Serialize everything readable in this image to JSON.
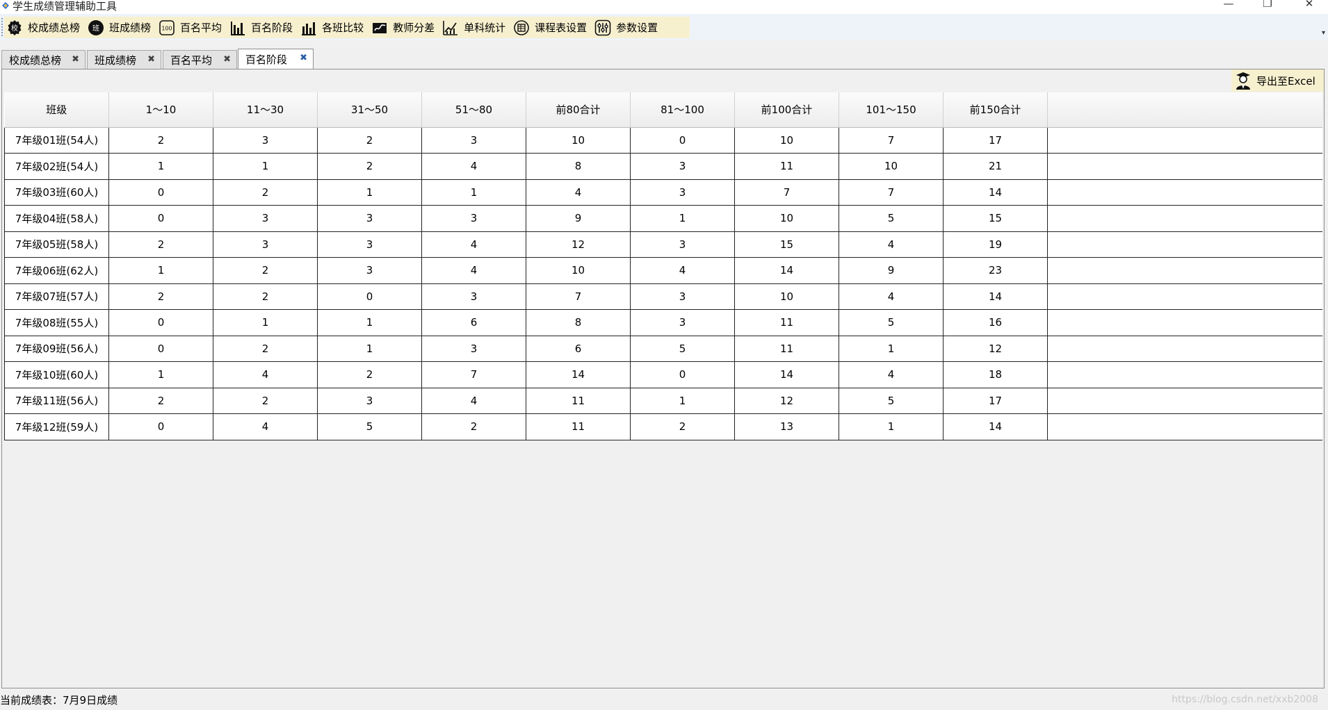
{
  "window": {
    "title": "学生成绩管理辅助工具",
    "min_glyph": "—",
    "max_glyph": "❐",
    "close_glyph": "✕"
  },
  "toolbar": {
    "buttons": [
      {
        "label": "校成绩总榜",
        "icon": "school-badge-icon",
        "icon_text": "校"
      },
      {
        "label": "班成绩榜",
        "icon": "class-badge-icon",
        "icon_text": "班"
      },
      {
        "label": "百名平均",
        "icon": "hundred-icon",
        "icon_text": "100"
      },
      {
        "label": "百名阶段",
        "icon": "bar-chart-icon"
      },
      {
        "label": "各班比较",
        "icon": "bar-compare-icon"
      },
      {
        "label": "教师分差",
        "icon": "signature-icon"
      },
      {
        "label": "单科统计",
        "icon": "line-chart-icon"
      },
      {
        "label": "课程表设置",
        "icon": "schedule-icon"
      },
      {
        "label": "参数设置",
        "icon": "sliders-icon"
      }
    ],
    "overflow_glyph": "▾"
  },
  "tabs": [
    {
      "label": "校成绩总榜",
      "active": false
    },
    {
      "label": "班成绩榜",
      "active": false
    },
    {
      "label": "百名平均",
      "active": false
    },
    {
      "label": "百名阶段",
      "active": true
    }
  ],
  "tab_close_glyph": "✖",
  "export": {
    "label": "导出至Excel",
    "icon": "teacher-icon"
  },
  "table": {
    "columns": [
      "班级",
      "1～10",
      "11～30",
      "31～50",
      "51～80",
      "前80合计",
      "81～100",
      "前100合计",
      "101～150",
      "前150合计"
    ],
    "rows": [
      [
        "7年级01班(54人)",
        "2",
        "3",
        "2",
        "3",
        "10",
        "0",
        "10",
        "7",
        "17"
      ],
      [
        "7年级02班(54人)",
        "1",
        "1",
        "2",
        "4",
        "8",
        "3",
        "11",
        "10",
        "21"
      ],
      [
        "7年级03班(60人)",
        "0",
        "2",
        "1",
        "1",
        "4",
        "3",
        "7",
        "7",
        "14"
      ],
      [
        "7年级04班(58人)",
        "0",
        "3",
        "3",
        "3",
        "9",
        "1",
        "10",
        "5",
        "15"
      ],
      [
        "7年级05班(58人)",
        "2",
        "3",
        "3",
        "4",
        "12",
        "3",
        "15",
        "4",
        "19"
      ],
      [
        "7年级06班(62人)",
        "1",
        "2",
        "3",
        "4",
        "10",
        "4",
        "14",
        "9",
        "23"
      ],
      [
        "7年级07班(57人)",
        "2",
        "2",
        "0",
        "3",
        "7",
        "3",
        "10",
        "4",
        "14"
      ],
      [
        "7年级08班(55人)",
        "0",
        "1",
        "1",
        "6",
        "8",
        "3",
        "11",
        "5",
        "16"
      ],
      [
        "7年级09班(56人)",
        "0",
        "2",
        "1",
        "3",
        "6",
        "5",
        "11",
        "1",
        "12"
      ],
      [
        "7年级10班(60人)",
        "1",
        "4",
        "2",
        "7",
        "14",
        "0",
        "14",
        "4",
        "18"
      ],
      [
        "7年级11班(56人)",
        "2",
        "2",
        "3",
        "4",
        "11",
        "1",
        "12",
        "5",
        "17"
      ],
      [
        "7年级12班(59人)",
        "0",
        "4",
        "5",
        "2",
        "11",
        "2",
        "13",
        "1",
        "14"
      ]
    ]
  },
  "status": {
    "text": "当前成绩表：7月9日成绩",
    "watermark": "https://blog.csdn.net/xxb2008"
  },
  "colors": {
    "toolbar_bg": "#eef3fa",
    "toolbar_strip": "#f7f0cf",
    "active_tab_close": "#2a5fa5"
  }
}
